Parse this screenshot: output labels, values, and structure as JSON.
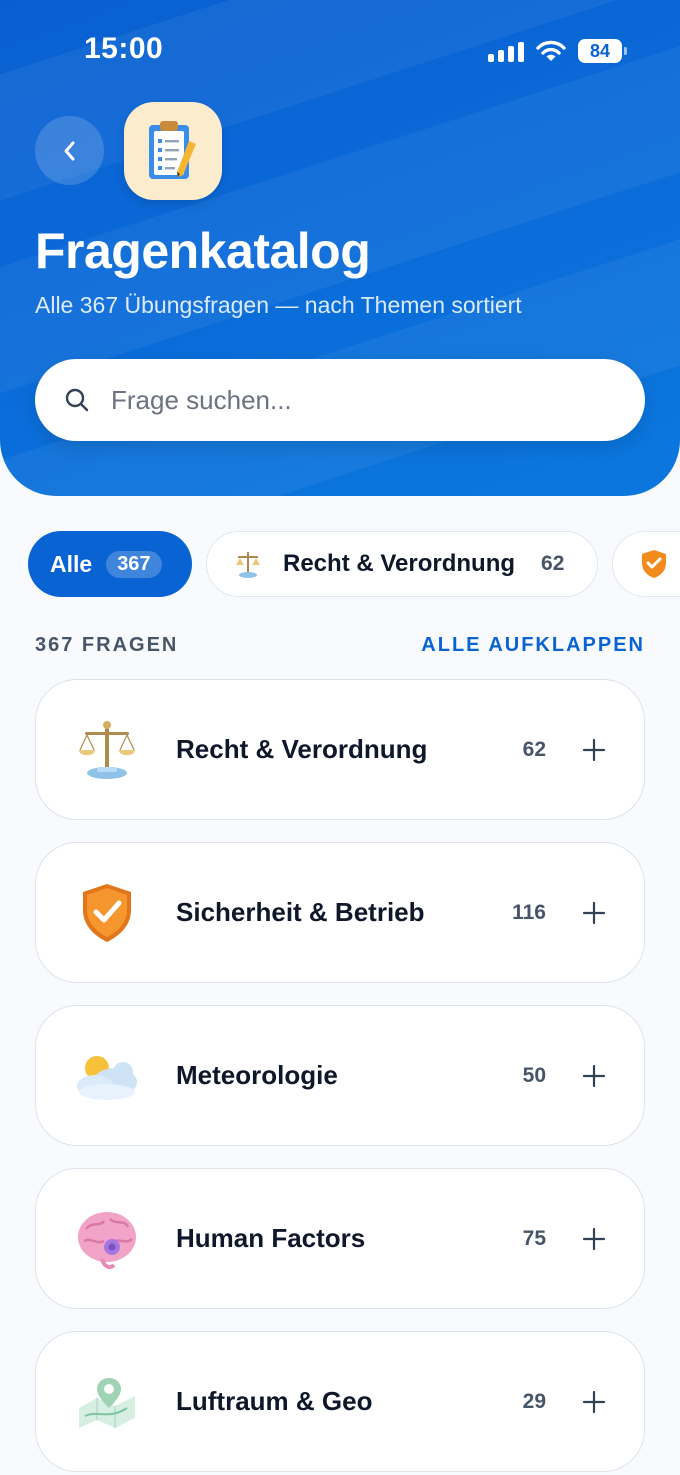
{
  "status_bar": {
    "time": "15:00",
    "battery": "84"
  },
  "header": {
    "title": "Fragenkatalog",
    "subtitle": "Alle 367 Übungsfragen — nach Themen sortiert"
  },
  "search": {
    "placeholder": "Frage suchen..."
  },
  "filters": [
    {
      "label": "Alle",
      "count": "367",
      "active": true
    },
    {
      "label": "Recht & Verordnung",
      "count": "62",
      "icon": "scales-icon",
      "active": false
    },
    {
      "label": "",
      "count": "",
      "icon": "shield-icon",
      "active": false
    }
  ],
  "list": {
    "count_label": "367 FRAGEN",
    "expand_all_label": "ALLE AUFKLAPPEN"
  },
  "categories": [
    {
      "title": "Recht & Verordnung",
      "count": "62",
      "icon": "scales-icon"
    },
    {
      "title": "Sicherheit & Betrieb",
      "count": "116",
      "icon": "shield-check-icon"
    },
    {
      "title": "Meteorologie",
      "count": "50",
      "icon": "sun-cloud-icon"
    },
    {
      "title": "Human Factors",
      "count": "75",
      "icon": "brain-icon"
    },
    {
      "title": "Luftraum & Geo",
      "count": "29",
      "icon": "map-pin-icon"
    }
  ],
  "colors": {
    "primary": "#0a63d3",
    "background": "#f8fafd",
    "shield": "#f28b1e"
  }
}
